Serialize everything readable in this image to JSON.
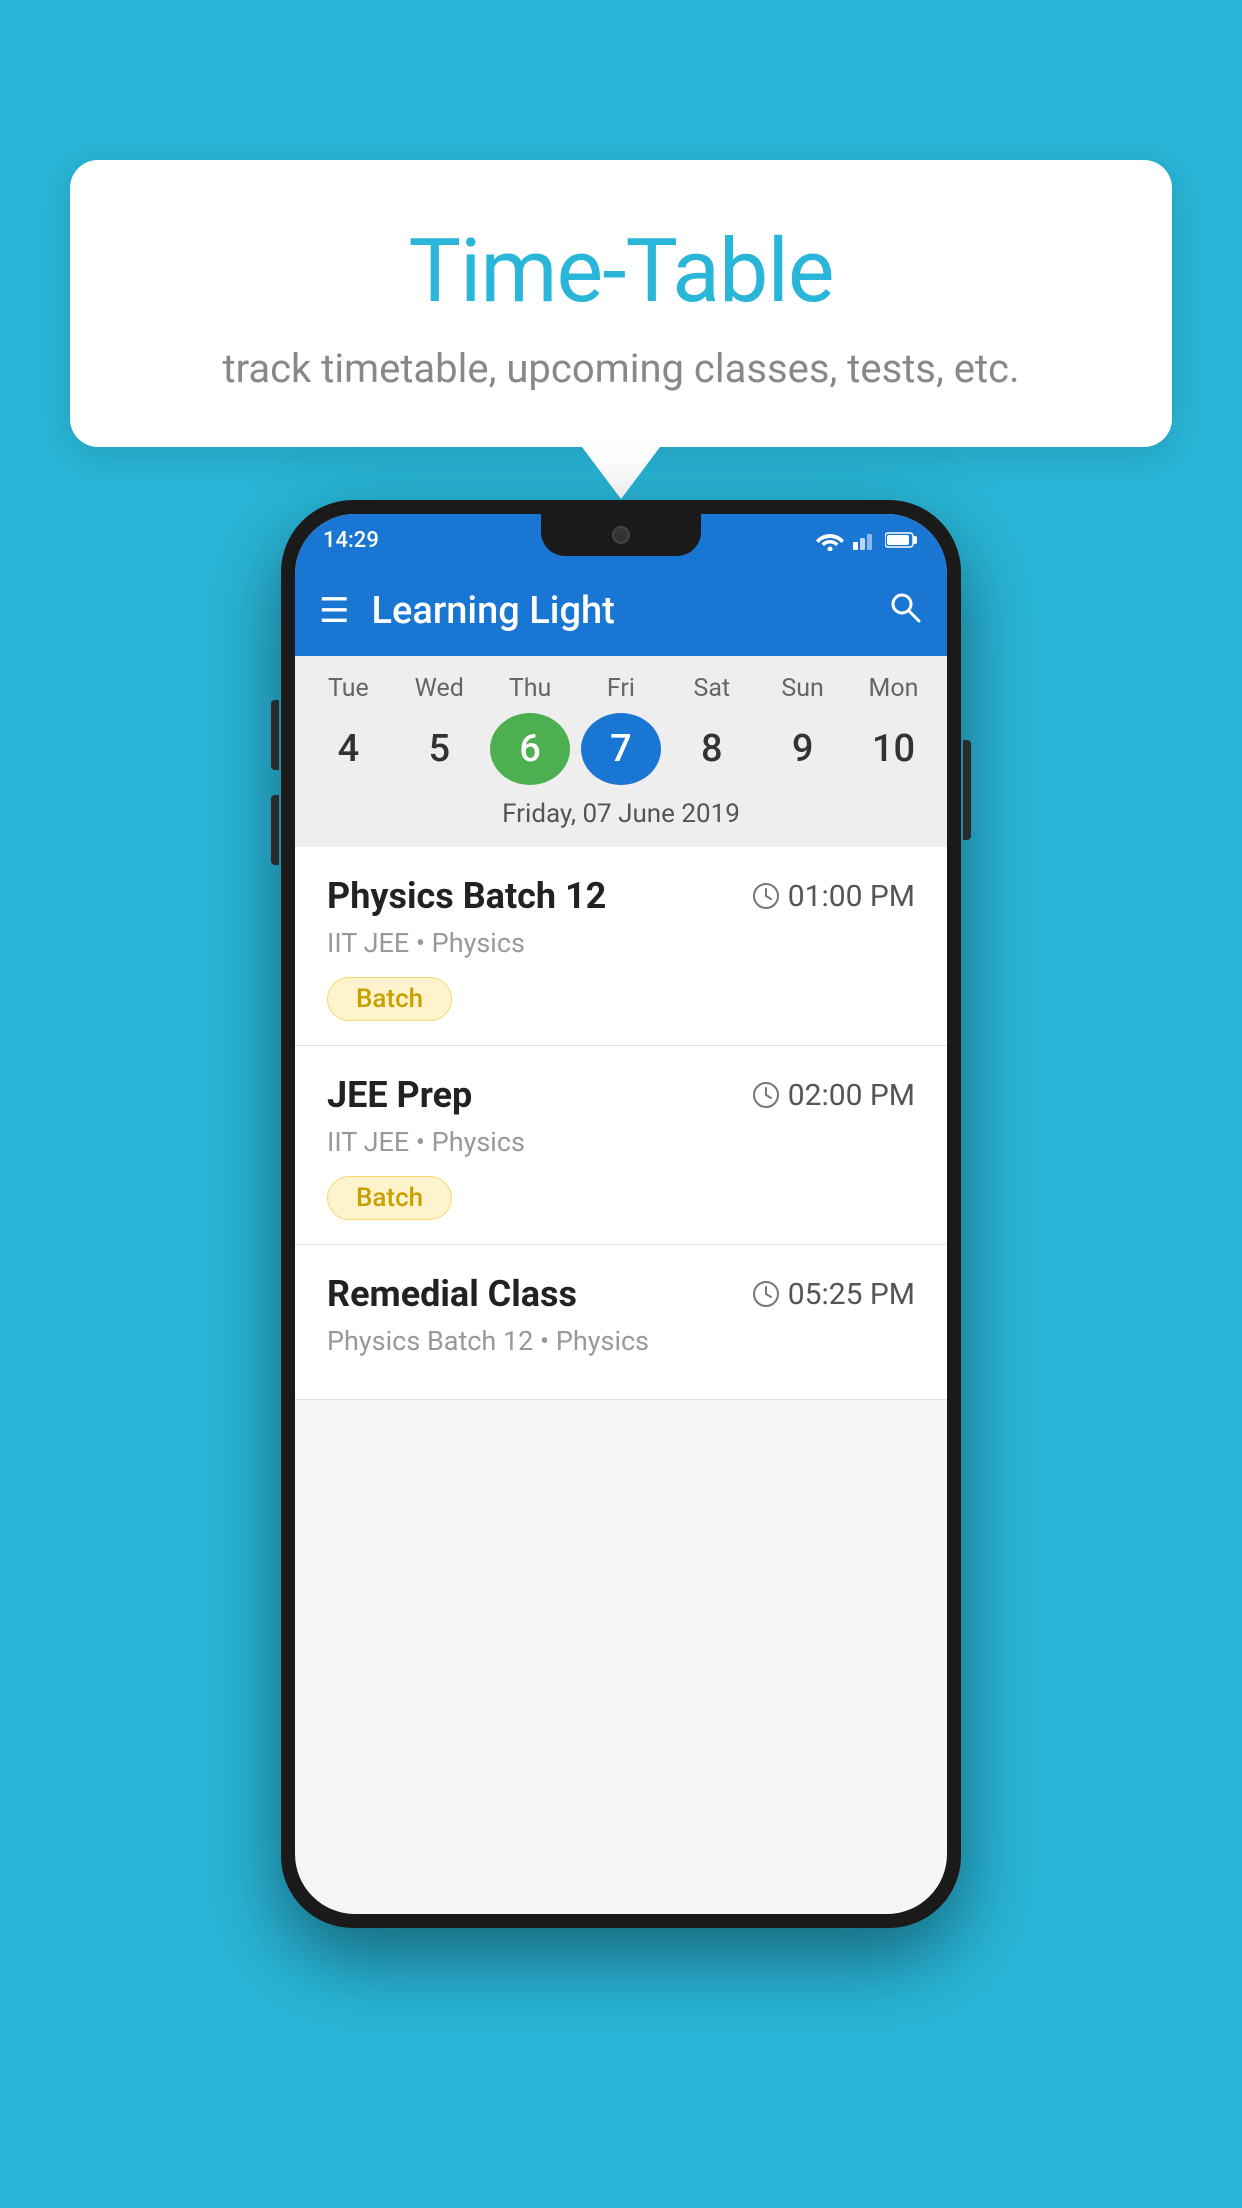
{
  "background_color": "#29b6d8",
  "tooltip": {
    "title": "Time-Table",
    "subtitle": "track timetable, upcoming classes, tests, etc."
  },
  "phone": {
    "status_bar": {
      "time": "14:29"
    },
    "toolbar": {
      "app_name": "Learning Light",
      "menu_icon": "☰",
      "search_icon": "🔍"
    },
    "calendar": {
      "days": [
        {
          "label": "Tue",
          "num": "4",
          "state": "normal"
        },
        {
          "label": "Wed",
          "num": "5",
          "state": "normal"
        },
        {
          "label": "Thu",
          "num": "6",
          "state": "today"
        },
        {
          "label": "Fri",
          "num": "7",
          "state": "selected"
        },
        {
          "label": "Sat",
          "num": "8",
          "state": "normal"
        },
        {
          "label": "Sun",
          "num": "9",
          "state": "normal"
        },
        {
          "label": "Mon",
          "num": "10",
          "state": "normal"
        }
      ],
      "selected_date_label": "Friday, 07 June 2019"
    },
    "classes": [
      {
        "name": "Physics Batch 12",
        "time": "01:00 PM",
        "meta": "IIT JEE • Physics",
        "tag": "Batch"
      },
      {
        "name": "JEE Prep",
        "time": "02:00 PM",
        "meta": "IIT JEE • Physics",
        "tag": "Batch"
      },
      {
        "name": "Remedial Class",
        "time": "05:25 PM",
        "meta": "Physics Batch 12 • Physics",
        "tag": ""
      }
    ]
  }
}
